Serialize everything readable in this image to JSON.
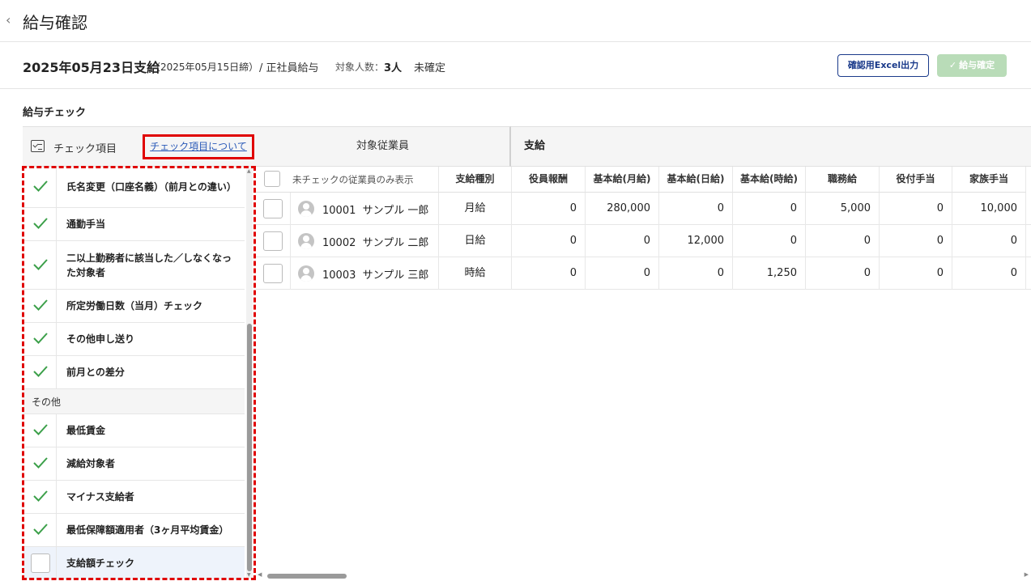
{
  "header": {
    "title": "給与確認",
    "back_icon": "‹"
  },
  "info": {
    "pay_date": "2025年05月23日支給",
    "close_date": "（2025年05月15日締）",
    "pay_type": "/ 正社員給与",
    "count_label": "対象人数：",
    "count_value": "3人",
    "status": "未確定",
    "excel_button": "確認用Excel出力",
    "confirm_button": "給与確定",
    "confirm_icon": "✓"
  },
  "section": {
    "title": "給与チェック"
  },
  "checklist": {
    "header_label": "チェック項目",
    "about_link": "チェック項目について",
    "items": [
      {
        "label": "氏名変更（口座名義）（前月との違い）",
        "checked": true
      },
      {
        "label": "通勤手当",
        "checked": true
      },
      {
        "label": "二以上勤務者に該当した／しなくなった対象者",
        "checked": true
      },
      {
        "label": "所定労働日数（当月）チェック",
        "checked": true
      },
      {
        "label": "その他申し送り",
        "checked": true
      },
      {
        "label": "前月との差分",
        "checked": true
      }
    ],
    "group_label": "その他",
    "other_items": [
      {
        "label": "最低賃金",
        "checked": true
      },
      {
        "label": "減給対象者",
        "checked": true
      },
      {
        "label": "マイナス支給者",
        "checked": true
      },
      {
        "label": "最低保障額適用者（3ヶ月平均賃金）",
        "checked": true
      },
      {
        "label": "支給額チェック",
        "checked": false
      }
    ]
  },
  "table": {
    "group_employee": "対象従業員",
    "group_pay": "支給",
    "filter_label": "未チェックの従業員のみ表示",
    "columns": [
      "支給種別",
      "役員報酬",
      "基本給(月給)",
      "基本給(日給)",
      "基本給(時給)",
      "職務給",
      "役付手当",
      "家族手当"
    ],
    "rows": [
      {
        "employee": "10001  サンプル 一郎",
        "values": [
          "月給",
          "0",
          "280,000",
          "0",
          "0",
          "5,000",
          "0",
          "10,000"
        ]
      },
      {
        "employee": "10002  サンプル 二郎",
        "values": [
          "日給",
          "0",
          "0",
          "12,000",
          "0",
          "0",
          "0",
          "0"
        ]
      },
      {
        "employee": "10003  サンプル 三郎",
        "values": [
          "時給",
          "0",
          "0",
          "0",
          "1,250",
          "0",
          "0",
          "0"
        ]
      }
    ]
  },
  "colors": {
    "accent": "#1a3a8a",
    "check": "#3ca04a",
    "highlight": "#e00000",
    "confirm_disabled": "#b9dcb8"
  }
}
